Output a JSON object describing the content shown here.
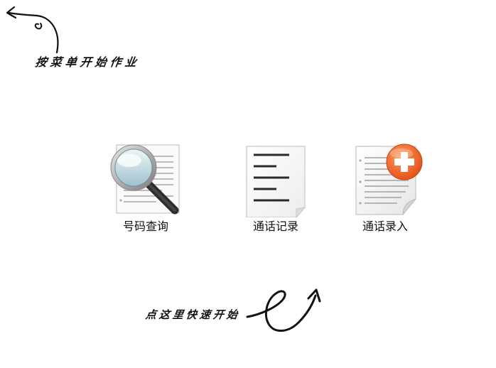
{
  "hints": {
    "menu_hint": "按菜单开始作业",
    "quick_hint": "点这里快速开始"
  },
  "tiles": [
    {
      "label": "号码查询",
      "icon": "magnifier-document-icon"
    },
    {
      "label": "通话记录",
      "icon": "document-lines-icon"
    },
    {
      "label": "通话录入",
      "icon": "document-add-icon"
    }
  ],
  "colors": {
    "accent_orange": "#f0622a",
    "text": "#111111",
    "background": "#ffffff"
  }
}
